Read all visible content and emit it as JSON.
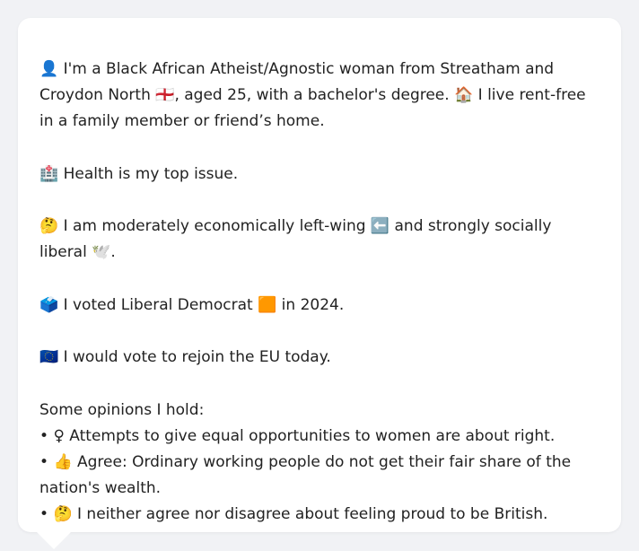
{
  "profile": {
    "intro": {
      "icon": "👤",
      "text_a": " I'm a Black African Atheist/Agnostic woman from Streatham and Croydon North ",
      "flag": "🏴󠁧󠁢󠁥󠁮󠁧󠁿",
      "text_b": ", aged 25, with a bachelor's degree. ",
      "home_icon": "🏠",
      "text_c": " I live rent-free in a family member or friend’s home."
    },
    "health": {
      "icon": "🏥",
      "text": " Health is my top issue."
    },
    "economics": {
      "icon": "🤔",
      "text_a": " I am moderately economically left-wing ",
      "left_arrow_icon": "⬅️",
      "text_b": " and strongly socially liberal ",
      "dove_icon": "🕊️",
      "text_c": "."
    },
    "vote": {
      "icon": "🗳️",
      "text_a": " I voted Liberal Democrat ",
      "party_icon": "🟧",
      "text_b": " in 2024."
    },
    "eu": {
      "icon": "🇪🇺",
      "text": " I would vote to rejoin the EU today."
    },
    "opinions": {
      "heading": "Some opinions I hold:",
      "items": [
        {
          "bullet": "•",
          "icon": "♀",
          "text": "  Attempts to give equal opportunities to women are about right."
        },
        {
          "bullet": "•",
          "icon": "👍",
          "text": " Agree: Ordinary working people do not get their fair share of the nation's wealth."
        },
        {
          "bullet": "•",
          "icon": "🤔",
          "text": " I neither agree nor disagree about feeling proud to be British."
        }
      ]
    }
  },
  "colors": {
    "page_background": "#f1f2f5",
    "card_background": "#ffffff",
    "text": "#222222"
  }
}
